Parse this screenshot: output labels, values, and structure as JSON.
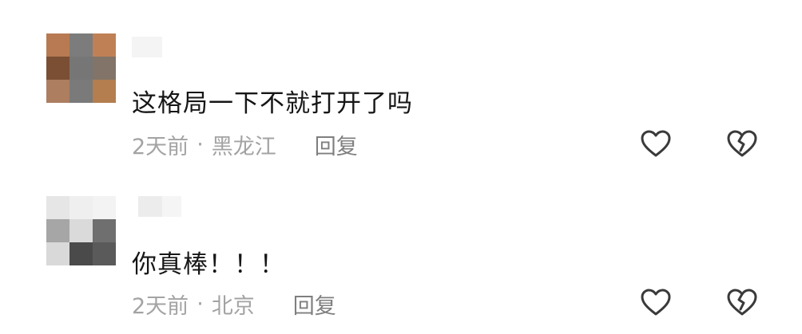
{
  "comments": [
    {
      "avatar_colors": [
        "#b87a52",
        "#7c7c7c",
        "#c08056",
        "#7a4f34",
        "#767676",
        "#827468",
        "#ad7e60",
        "#7a7a7a",
        "#b47e4f"
      ],
      "text": "这格局一下不就打开了吗",
      "time": "2天前",
      "separator": "·",
      "location": "黑龙江",
      "reply_label": "回复",
      "like_icon": "heart-outline-icon",
      "dislike_icon": "broken-heart-icon"
    },
    {
      "avatar_colors": [
        "#e6e6e6",
        "#efefef",
        "#f3f3f3",
        "#a6a6a6",
        "#dadada",
        "#6f6f6f",
        "#d9d9d9",
        "#4a4a4a",
        "#5a5a5a"
      ],
      "text": "你真棒！！！",
      "time": "2天前",
      "separator": "·",
      "location": "北京",
      "reply_label": "回复",
      "like_icon": "heart-outline-icon",
      "dislike_icon": "broken-heart-icon"
    }
  ]
}
